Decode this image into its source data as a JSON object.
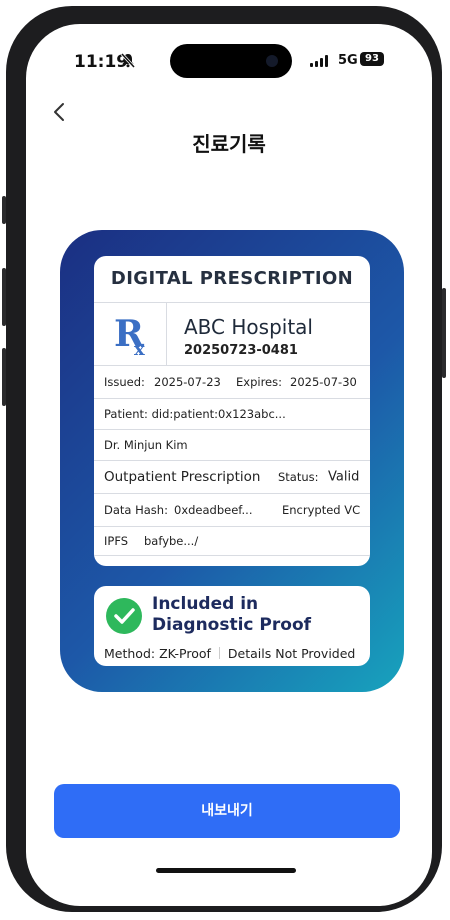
{
  "status_bar": {
    "time": "11:19",
    "network": "5G",
    "battery": "93"
  },
  "header": {
    "title": "진료기록"
  },
  "prescription": {
    "heading": "DIGITAL PRESCRIPTION",
    "hospital": "ABC Hospital",
    "rx_number": "20250723-0481",
    "issued_label": "Issued:",
    "issued_date": "2025-07-23",
    "expires_label": "Expires:",
    "expires_date": "2025-07-30",
    "patient": "Patient: did:patient:0x123abc...",
    "doctor": "Dr. Minjun Kim",
    "type": "Outpatient Prescription",
    "status_label": "Status:",
    "status_value": "Valid",
    "hash_label": "Data Hash:",
    "hash_value": "0xdeadbeef...",
    "credential": "Encrypted VC",
    "ipfs_label": "IPFS",
    "ipfs_value": "bafybe.../"
  },
  "proof": {
    "title": "Included in Diagnostic Proof",
    "method": "Method: ZK-Proof",
    "details": "Details Not Provided"
  },
  "actions": {
    "export_label": "내보내기"
  },
  "colors": {
    "primary": "#2f6df6",
    "card_start": "#1b2f82",
    "card_end": "#17a3bd",
    "success": "#2eb85c"
  }
}
